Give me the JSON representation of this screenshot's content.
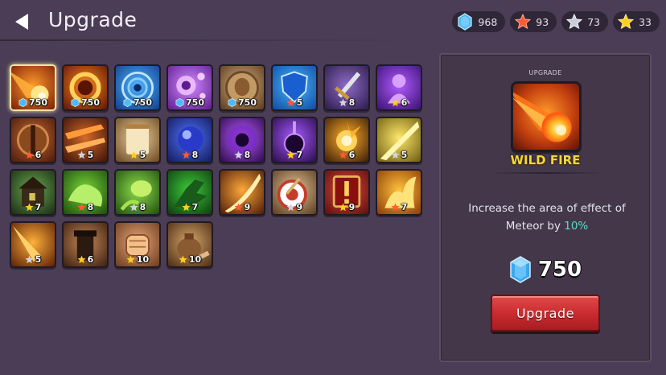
{
  "header": {
    "title": "Upgrade",
    "back_icon": "back-arrow-icon"
  },
  "currencies": [
    {
      "icon": "gem-icon",
      "value": "968",
      "color": "#5ec8ff"
    },
    {
      "icon": "red-star-icon",
      "value": "93",
      "color": "#ff5a33"
    },
    {
      "icon": "silver-star-icon",
      "value": "73",
      "color": "#c8ccd8"
    },
    {
      "icon": "gold-star-icon",
      "value": "33",
      "color": "#ffce1f"
    }
  ],
  "skills": [
    {
      "name": "wild-fire",
      "cost": "750",
      "currency": "gem",
      "selected": true
    },
    {
      "name": "fire-ring",
      "cost": "750",
      "currency": "gem"
    },
    {
      "name": "water-vortex",
      "cost": "750",
      "currency": "gem"
    },
    {
      "name": "bubbles",
      "cost": "750",
      "currency": "gem"
    },
    {
      "name": "fist-shield",
      "cost": "750",
      "currency": "gem"
    },
    {
      "name": "blue-shield",
      "cost": "5",
      "currency": "red-star"
    },
    {
      "name": "sword",
      "cost": "8",
      "currency": "silver-star"
    },
    {
      "name": "dark-figure",
      "cost": "6",
      "currency": "gold-star"
    },
    {
      "name": "barrel-shield",
      "cost": "6",
      "currency": "red-star"
    },
    {
      "name": "fire-streaks",
      "cost": "5",
      "currency": "silver-star"
    },
    {
      "name": "scroll",
      "cost": "5",
      "currency": "gold-star"
    },
    {
      "name": "blue-orb",
      "cost": "8",
      "currency": "red-star"
    },
    {
      "name": "shadow-orb",
      "cost": "8",
      "currency": "silver-star"
    },
    {
      "name": "chain-orb",
      "cost": "7",
      "currency": "gold-star"
    },
    {
      "name": "explosion",
      "cost": "6",
      "currency": "red-star"
    },
    {
      "name": "light-beam",
      "cost": "5",
      "currency": "silver-star"
    },
    {
      "name": "tower-house",
      "cost": "7",
      "currency": "gold-star"
    },
    {
      "name": "poison-cloud",
      "cost": "8",
      "currency": "red-star"
    },
    {
      "name": "green-slime",
      "cost": "8",
      "currency": "silver-star"
    },
    {
      "name": "green-hand",
      "cost": "7",
      "currency": "gold-star"
    },
    {
      "name": "fire-slash",
      "cost": "9",
      "currency": "red-star"
    },
    {
      "name": "target",
      "cost": "9",
      "currency": "silver-star"
    },
    {
      "name": "alert-card",
      "cost": "9",
      "currency": "gold-star"
    },
    {
      "name": "flame-burst",
      "cost": "7",
      "currency": "red-star"
    },
    {
      "name": "fire-trail",
      "cost": "5",
      "currency": "silver-star"
    },
    {
      "name": "dark-tower",
      "cost": "6",
      "currency": "gold-star"
    },
    {
      "name": "fist",
      "cost": "10",
      "currency": "gold-star"
    },
    {
      "name": "money-bag",
      "cost": "10",
      "currency": "gold-star"
    }
  ],
  "panel": {
    "label": "UPGRADE",
    "skill_name": "WILD FIRE",
    "desc_before": "Increase the area of effect of Meteor by ",
    "desc_highlight": "10%",
    "price": "750",
    "button_label": "Upgrade"
  }
}
